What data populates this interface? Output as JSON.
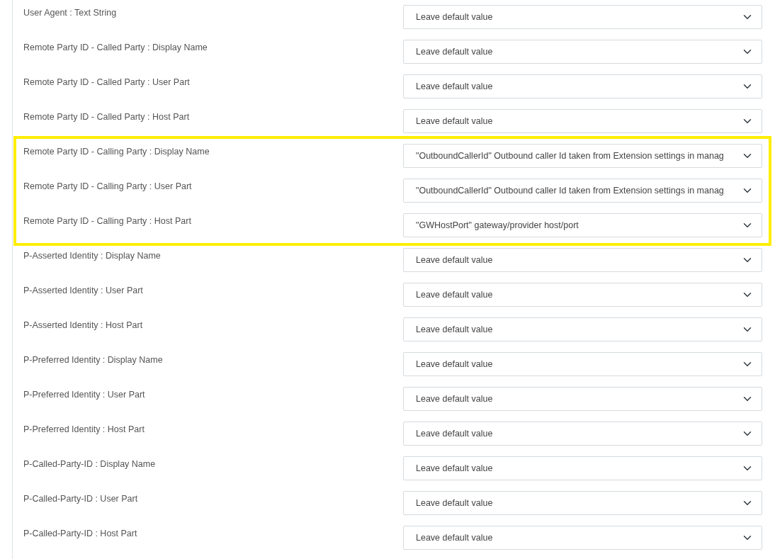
{
  "rows": [
    {
      "label": "User Agent : Text String",
      "value": "Leave default value",
      "highlighted": false
    },
    {
      "label": "Remote Party ID - Called Party : Display Name",
      "value": "Leave default value",
      "highlighted": false
    },
    {
      "label": "Remote Party ID - Called Party : User Part",
      "value": "Leave default value",
      "highlighted": false
    },
    {
      "label": "Remote Party ID - Called Party : Host Part",
      "value": "Leave default value",
      "highlighted": false
    },
    {
      "label": "Remote Party ID - Calling Party : Display Name",
      "value": "\"OutboundCallerId\" Outbound caller Id taken from Extension settings in manag",
      "highlighted": true
    },
    {
      "label": "Remote Party ID - Calling Party : User Part",
      "value": "\"OutboundCallerId\" Outbound caller Id taken from Extension settings in manag",
      "highlighted": true
    },
    {
      "label": "Remote Party ID - Calling Party : Host Part",
      "value": "\"GWHostPort\" gateway/provider host/port",
      "highlighted": true
    },
    {
      "label": "P-Asserted Identity : Display Name",
      "value": "Leave default value",
      "highlighted": false
    },
    {
      "label": "P-Asserted Identity : User Part",
      "value": "Leave default value",
      "highlighted": false
    },
    {
      "label": "P-Asserted Identity : Host Part",
      "value": "Leave default value",
      "highlighted": false
    },
    {
      "label": "P-Preferred Identity : Display Name",
      "value": "Leave default value",
      "highlighted": false
    },
    {
      "label": "P-Preferred Identity : User Part",
      "value": "Leave default value",
      "highlighted": false
    },
    {
      "label": "P-Preferred Identity : Host Part",
      "value": "Leave default value",
      "highlighted": false
    },
    {
      "label": "P-Called-Party-ID : Display Name",
      "value": "Leave default value",
      "highlighted": false
    },
    {
      "label": "P-Called-Party-ID : User Part",
      "value": "Leave default value",
      "highlighted": false
    },
    {
      "label": "P-Called-Party-ID : Host Part",
      "value": "Leave default value",
      "highlighted": false
    }
  ]
}
